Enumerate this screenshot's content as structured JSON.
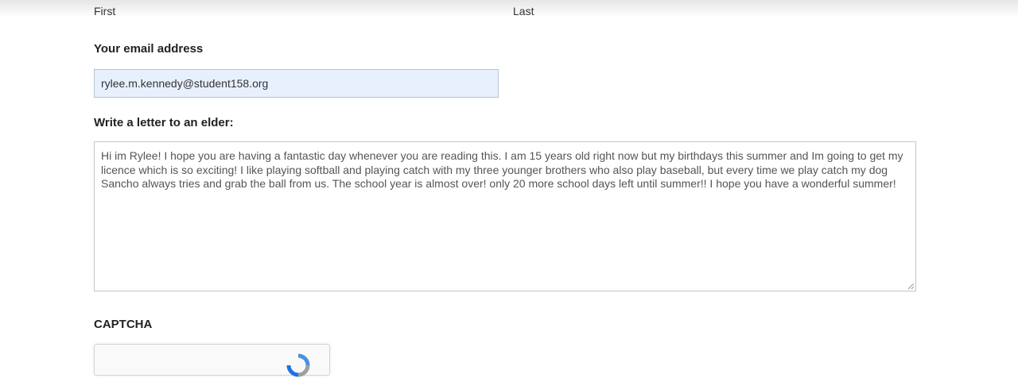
{
  "name_fields": {
    "first_label": "First",
    "last_label": "Last"
  },
  "email": {
    "label": "Your email address",
    "value": "rylee.m.kennedy@student158.org"
  },
  "letter": {
    "label": "Write a letter to an elder:",
    "value": "Hi im Rylee! I hope you are having a fantastic day whenever you are reading this. I am 15 years old right now but my birthdays this summer and Im going to get my licence which is so exciting! I like playing softball and playing catch with my three younger brothers who also play baseball, but every time we play catch my dog Sancho always tries and grab the ball from us. The school year is almost over! only 20 more school days left until summer!! I hope you have a wonderful summer!"
  },
  "captcha": {
    "label": "CAPTCHA",
    "icon": "recaptcha-logo-icon"
  },
  "colors": {
    "autofill_background": "#e8f0fe",
    "recaptcha_blue": "#4a90e2"
  }
}
